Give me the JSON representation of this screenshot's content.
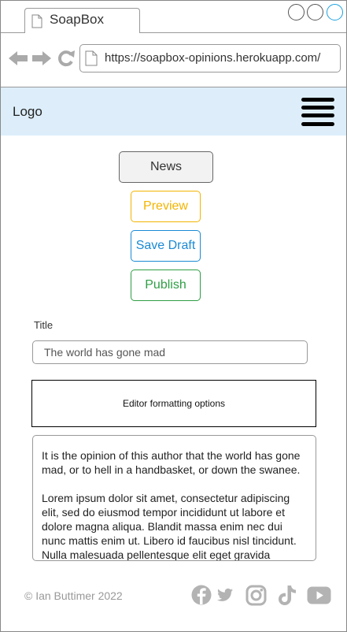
{
  "browser": {
    "tab_title": "SoapBox",
    "url": "https://soapbox-opinions.herokuapp.com/"
  },
  "header": {
    "logo": "Logo",
    "menu_icon": "hamburger-menu-icon"
  },
  "actions": {
    "news_label": "News",
    "preview_label": "Preview",
    "save_draft_label": "Save Draft",
    "publish_label": "Publish"
  },
  "form": {
    "title_label": "Title",
    "title_value": "The world has gone mad",
    "toolbar_label": "Editor formatting options",
    "body_paragraphs": [
      "It is the opinion of this author that the world has gone mad, or to hell in a handbasket, or down the swanee.",
      "Lorem ipsum dolor sit amet, consectetur adipiscing elit, sed do eiusmod tempor incididunt ut labore et dolore magna aliqua. Blandit massa enim nec dui nunc mattis enim ut. Libero id faucibus nisl tincidunt. Nulla malesuada pellentesque elit eget gravida"
    ]
  },
  "footer": {
    "copyright": "© Ian Buttimer 2022",
    "social_icons": [
      "facebook-icon",
      "twitter-icon",
      "instagram-icon",
      "tiktok-icon",
      "youtube-icon"
    ]
  },
  "colors": {
    "header_bg": "#ddeefa",
    "preview": "#f4b400",
    "save_draft": "#1a8ad4",
    "publish": "#2e9e44",
    "icon_grey": "#b3b3b3"
  }
}
